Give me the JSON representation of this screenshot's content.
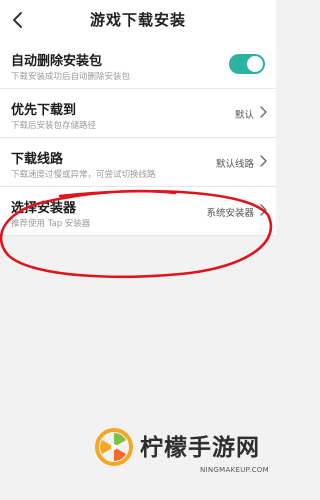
{
  "header": {
    "title": "游戏下载安装",
    "back_icon": "chevron-left-icon"
  },
  "settings": {
    "auto_delete": {
      "title": "自动删除安装包",
      "desc": "下载安装成功后自动删除安装包",
      "toggle_on": true,
      "toggle_color": "#2bb3a0"
    },
    "download_location": {
      "title": "优先下载到",
      "desc": "下载后安装包存储路径",
      "value": "默认"
    },
    "download_line": {
      "title": "下载线路",
      "desc": "下载速度过慢或异常，可尝试切换线路",
      "value": "默认线路"
    },
    "installer": {
      "title": "选择安装器",
      "desc": "推荐使用 Tap 安装器",
      "value": "系统安装器"
    }
  },
  "annotation": {
    "color": "#e0151c"
  },
  "watermark": {
    "text": "柠檬手游网",
    "url": "NINGMAKEUP.COM",
    "logo_colors": [
      "#f5a623",
      "#7cc242",
      "#f26b2b"
    ]
  }
}
